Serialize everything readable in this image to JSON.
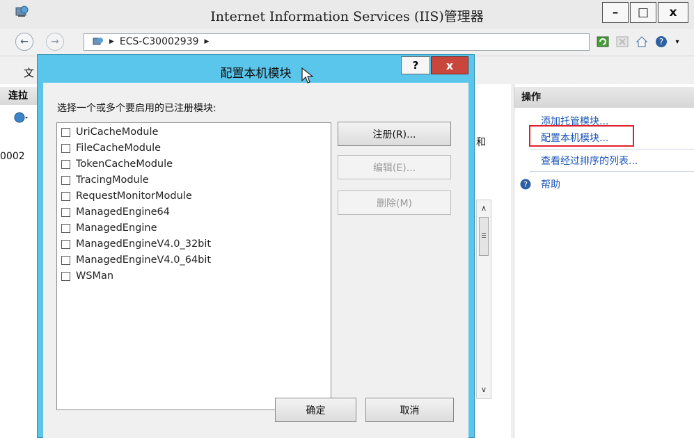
{
  "window": {
    "title": "Internet Information Services (IIS)管理器",
    "min": "–",
    "max": "□",
    "close": "x"
  },
  "address": {
    "crumb": "ECS-C30002939"
  },
  "menu": {
    "first_char": "文"
  },
  "left": {
    "head": "连拉",
    "item_fragment": "0002"
  },
  "middle": {
    "fragment": "和",
    "scroll_glyphs": [
      "ε",
      "r",
      "ε",
      "ε",
      "ε",
      "r",
      "ε",
      "ε",
      "ε"
    ]
  },
  "actions": {
    "header": "操作",
    "items": [
      "添加托管模块...",
      "配置本机模块...",
      "查看经过排序的列表...",
      "帮助"
    ]
  },
  "dialog": {
    "title": "配置本机模块",
    "help": "?",
    "close": "x",
    "prompt": "选择一个或多个要启用的已注册模块:",
    "modules": [
      "UriCacheModule",
      "FileCacheModule",
      "TokenCacheModule",
      "TracingModule",
      "RequestMonitorModule",
      "ManagedEngine64",
      "ManagedEngine",
      "ManagedEngineV4.0_32bit",
      "ManagedEngineV4.0_64bit",
      "WSMan"
    ],
    "register": "注册(R)...",
    "edit": "编辑(E)...",
    "remove": "删除(M)",
    "ok": "确定",
    "cancel": "取消"
  },
  "colors": {
    "dialog_frame": "#5bc6eb",
    "close_red": "#c9463d",
    "highlight": "#e0202a",
    "link": "#1a56b8"
  }
}
